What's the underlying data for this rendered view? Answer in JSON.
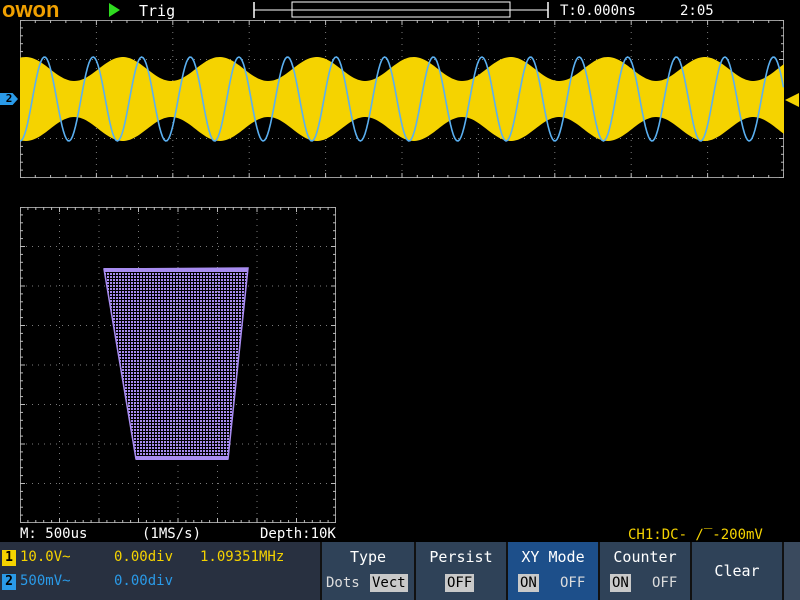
{
  "brand": {
    "logo_text": "OWON"
  },
  "topbar": {
    "run_state": "Trig",
    "time_offset": "T:0.000ns",
    "clock": "2:05"
  },
  "markers": {
    "ch2_label": "2"
  },
  "status": {
    "timebase": "M: 500us",
    "sample_rate": "(1MS/s)",
    "depth": "Depth:10K",
    "trigger": "CH1:DC-_∕‾-200mV"
  },
  "channels": [
    {
      "num": "1",
      "scale": "10.0V~",
      "position": "0.00div",
      "freq": "1.09351MHz",
      "color": "#f5d300"
    },
    {
      "num": "2",
      "scale": "500mV~",
      "position": "0.00div",
      "freq": "",
      "color": "#2a9ae8"
    }
  ],
  "menus": {
    "type": {
      "title": "Type",
      "opt_a": "Dots",
      "opt_b": "Vect"
    },
    "persist": {
      "title": "Persist",
      "value": "OFF"
    },
    "xy_mode": {
      "title": "XY Mode",
      "on": "ON",
      "off": "OFF"
    },
    "counter": {
      "title": "Counter",
      "on": "ON",
      "off": "OFF"
    },
    "clear": {
      "title": "Clear"
    }
  },
  "colors": {
    "ch1": "#f5d300",
    "ch2": "#5aaff0",
    "xy": "#a88cf0",
    "grid": "#7a7a7a",
    "logo": "#f0a000"
  }
}
